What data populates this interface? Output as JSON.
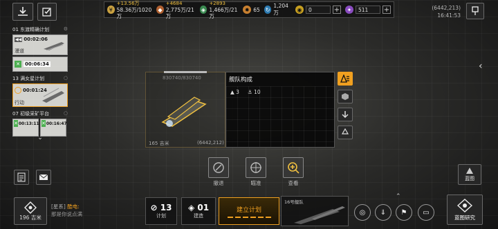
{
  "resources": {
    "credits": {
      "income": "+13.56万",
      "value": "58.36万/1020万"
    },
    "metal": {
      "income": "+4684",
      "value": "2,775万/21万"
    },
    "crystal": {
      "income": "+2893",
      "value": "1,466万/21万"
    },
    "fuel": {
      "value": "65"
    },
    "refresh": {
      "value": "1,204万"
    },
    "gold": {
      "value": "0"
    },
    "purple": {
      "value": "511"
    }
  },
  "coords": {
    "position": "(6442,213)",
    "time": "16:41:53"
  },
  "missions": [
    {
      "num": "01",
      "title": "东渡精确计划",
      "timer1": "00:02:06",
      "status1": "漫道",
      "timer2": "00:06:34"
    },
    {
      "num": "13",
      "title": "满女星计划",
      "timer1": "00:01:24",
      "status1": "行动"
    },
    {
      "num": "07",
      "title": "初级采矿平台",
      "timer1": "00:13:11",
      "timer2": "00:16:47"
    }
  ],
  "ship": {
    "hp": "830740/830740",
    "distance": "165 吉米",
    "coord": "(6442,212)"
  },
  "fleet": {
    "title": "舰队构成",
    "count_a": "3",
    "count_b": "10"
  },
  "actions": {
    "retreat": "撤退",
    "scout": "瞄准",
    "view": "查看"
  },
  "bottom": {
    "distance": "196 吉米",
    "sector_tag": "[星系]",
    "sector_name": "酷电:",
    "sector_sub": "那是你说点满",
    "plan_count": "13",
    "plan_label": "计划",
    "build_count": "01",
    "build_label": "建造",
    "build_plan": "建立计划",
    "fleet_tag": "16号舰队",
    "blueprint_top": "蓝图",
    "blueprint_research": "蓝图研究"
  },
  "colors": {
    "accent": "#f0a020",
    "panel": "#0c0c0c"
  }
}
